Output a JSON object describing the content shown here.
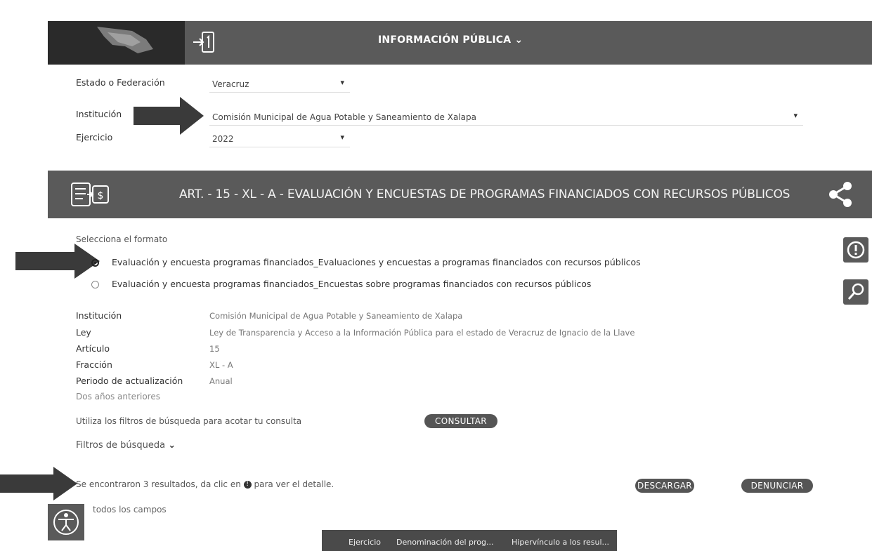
{
  "header": {
    "title": "INFORMACIÓN PÚBLICA",
    "title_chevron": "⌄"
  },
  "filters": {
    "estado_label": "Estado o Federación",
    "estado_value": "Veracruz",
    "institucion_label": "Institución",
    "institucion_value": "Comisión Municipal de Agua Potable y Saneamiento de Xalapa",
    "ejercicio_label": "Ejercicio",
    "ejercicio_value": "2022"
  },
  "section": {
    "title": "ART. - 15 - XL - A - EVALUACIÓN Y ENCUESTAS DE PROGRAMAS FINANCIADOS CON RECURSOS PÚBLICOS"
  },
  "format": {
    "prompt": "Selecciona el formato",
    "options": [
      {
        "label": "Evaluación y encuesta programas financiados_Evaluaciones y encuestas a programas financiados con recursos públicos",
        "selected": true
      },
      {
        "label": "Evaluación y encuesta programas financiados_Encuestas sobre programas financiados con recursos públicos",
        "selected": false
      }
    ]
  },
  "meta": {
    "institucion_label": "Institución",
    "institucion_value": "Comisión Municipal de Agua Potable y Saneamiento de Xalapa",
    "ley_label": "Ley",
    "ley_value": "Ley de Transparencia y Acceso a la Información Pública para el estado de Veracruz de Ignacio de la Llave",
    "articulo_label": "Artículo",
    "articulo_value": "15",
    "fraccion_label": "Fracción",
    "fraccion_value": "XL - A",
    "periodo_label": "Periodo de actualización",
    "periodo_value": "Anual",
    "dos_anos": "Dos años anteriores"
  },
  "search": {
    "hint": "Utiliza los filtros de búsqueda para acotar tu consulta",
    "consultar": "CONSULTAR",
    "filtros": "Filtros de búsqueda",
    "filtros_chevron": "⌄"
  },
  "results": {
    "text_before": "Se encontraron 3 resultados, da clic en",
    "text_after": "para ver el detalle.",
    "descargar": "DESCARGAR",
    "denunciar": "DENUNCIAR",
    "todos": "todos los campos"
  },
  "table_tabs": [
    "Ejercicio",
    "Denominación del prog...",
    "Hipervínculo a los resul..."
  ],
  "icons": {
    "login": "login-icon",
    "money_list": "money-list-icon",
    "share": "share-icon",
    "alert": "alert-icon",
    "tools": "tools-icon",
    "accessibility": "accessibility-icon",
    "info": "info-icon"
  },
  "colors": {
    "bar": "#5a5a5a",
    "arrow": "#3a3a3a"
  }
}
